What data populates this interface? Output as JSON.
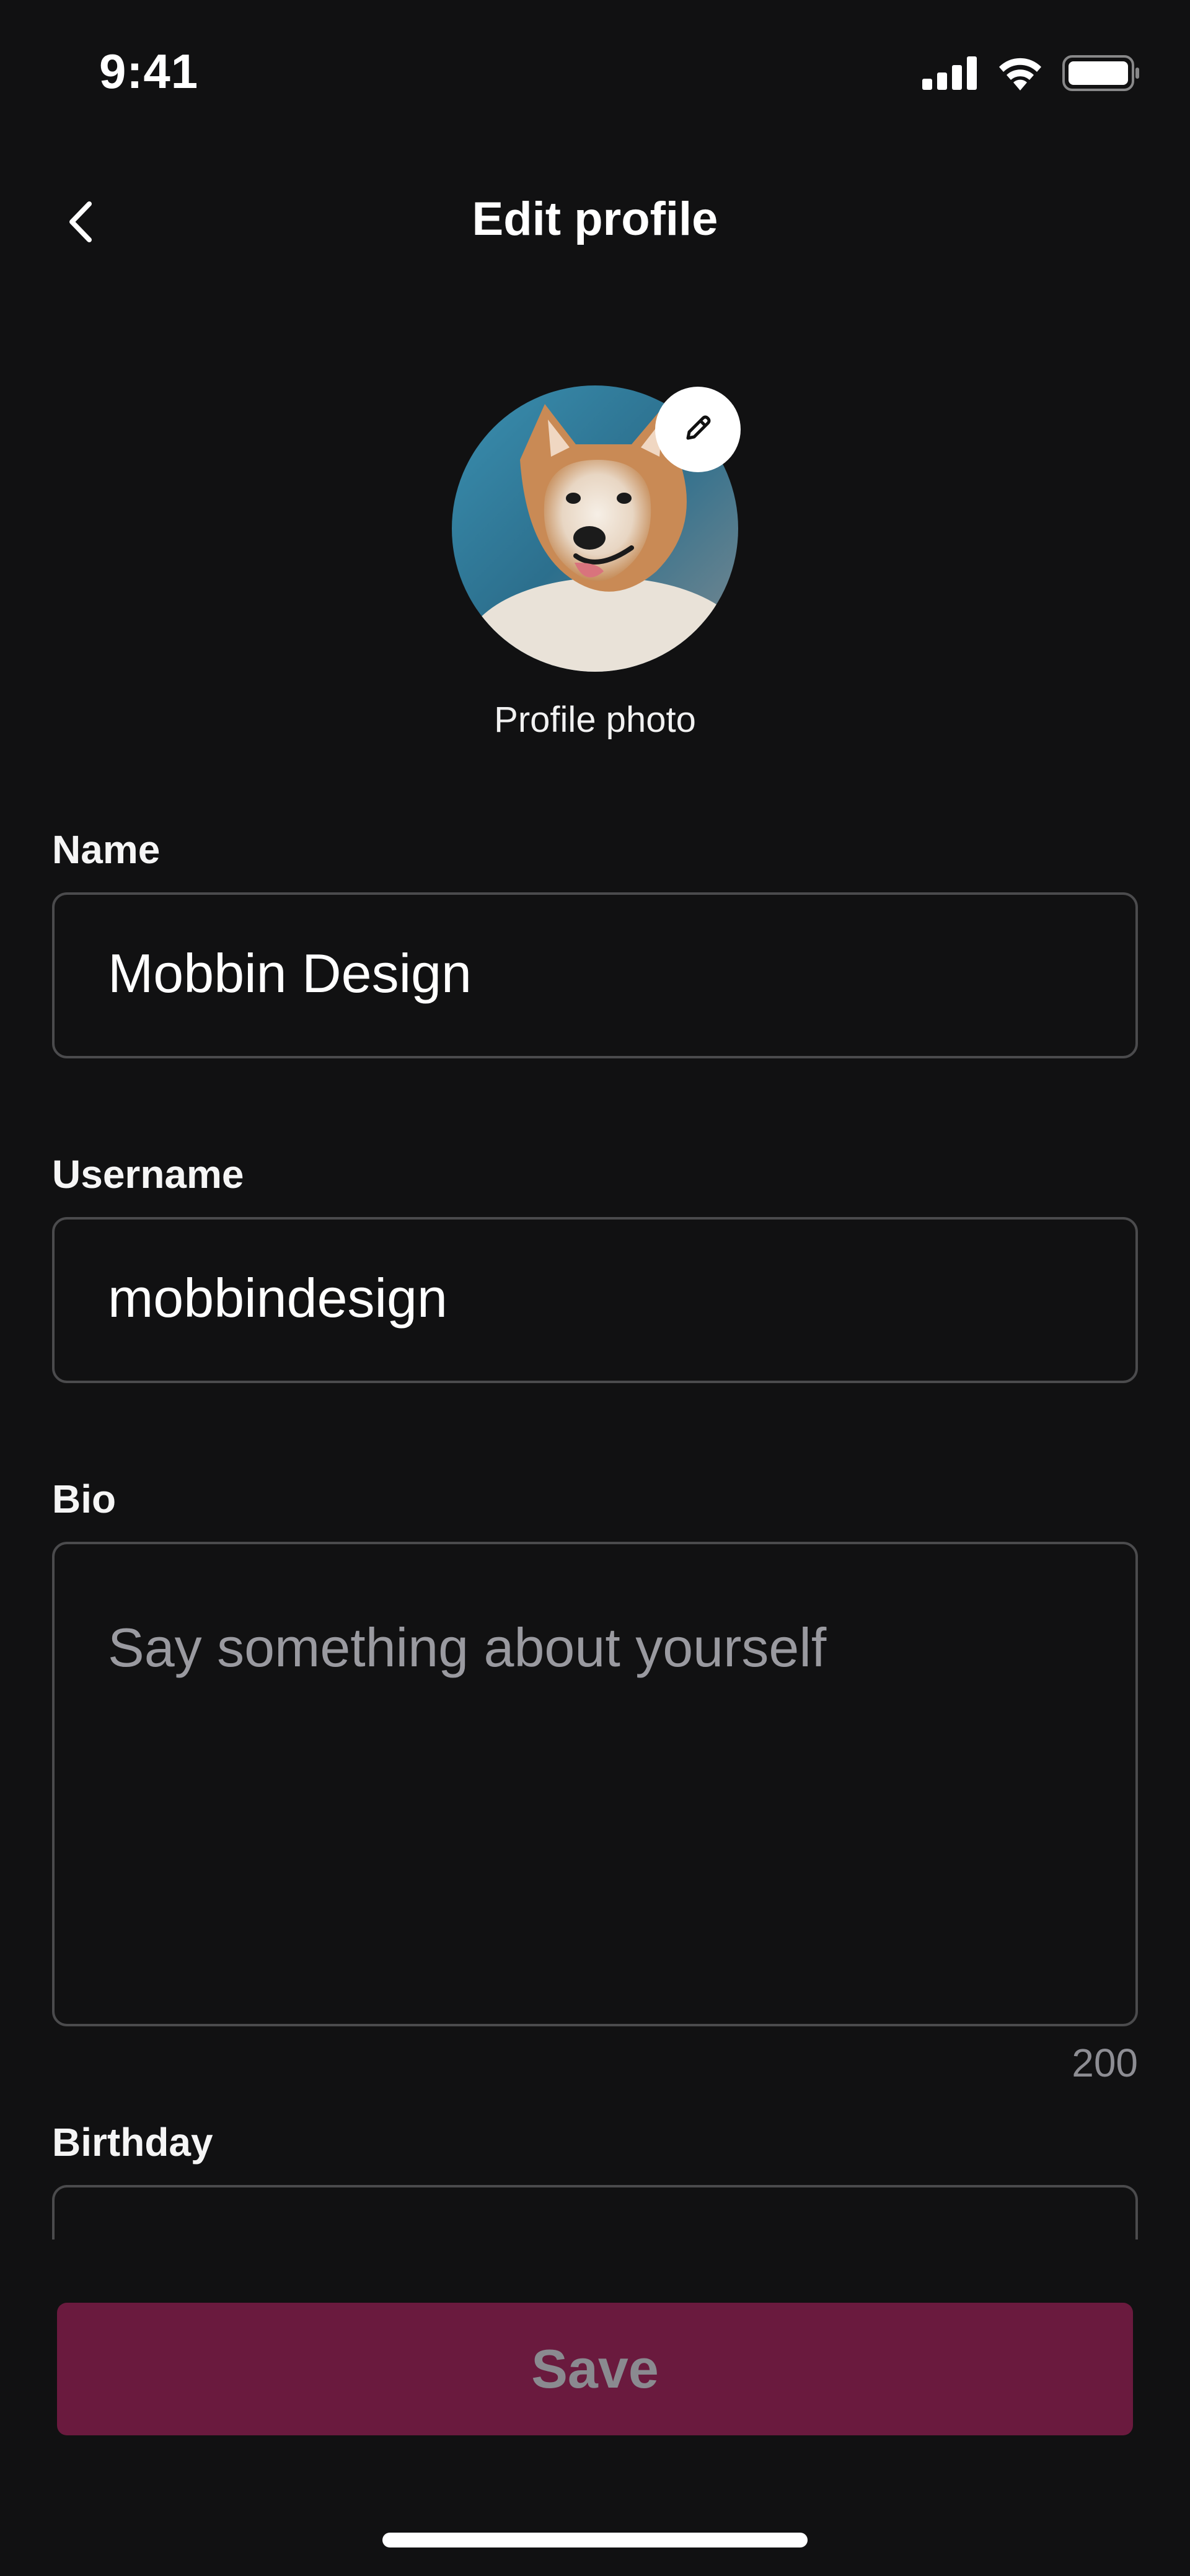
{
  "status_bar": {
    "time": "9:41",
    "icons": [
      "cellular-signal-icon",
      "wifi-icon",
      "battery-icon"
    ]
  },
  "header": {
    "title": "Edit profile",
    "back_icon": "chevron-left-icon"
  },
  "avatar": {
    "caption": "Profile photo",
    "edit_icon": "pencil-icon"
  },
  "form": {
    "name": {
      "label": "Name",
      "value": "Mobbin Design"
    },
    "username": {
      "label": "Username",
      "value": "mobbindesign"
    },
    "bio": {
      "label": "Bio",
      "value": "",
      "placeholder": "Say something about yourself",
      "char_count": "200"
    },
    "birthday": {
      "label": "Birthday",
      "value": ""
    }
  },
  "actions": {
    "save_label": "Save"
  },
  "colors": {
    "background": "#111112",
    "field_border": "#4b4b4d",
    "save_button_bg": "#6a1a3e",
    "save_button_text": "#8a8a90",
    "placeholder": "#9a9aa0"
  }
}
